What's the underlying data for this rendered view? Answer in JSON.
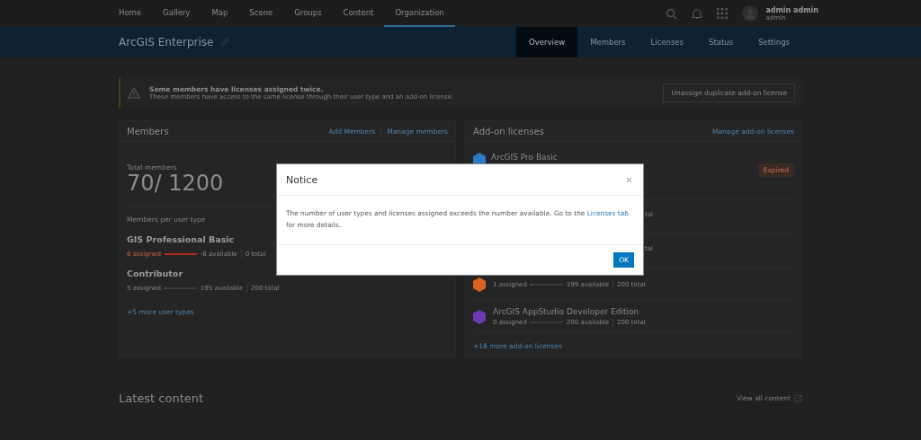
{
  "top_nav": {
    "tabs": [
      {
        "label": "Home",
        "selected": false
      },
      {
        "label": "Gallery",
        "selected": false
      },
      {
        "label": "Map",
        "selected": false
      },
      {
        "label": "Scene",
        "selected": false
      },
      {
        "label": "Groups",
        "selected": false
      },
      {
        "label": "Content",
        "selected": false
      },
      {
        "label": "Organization",
        "selected": true
      }
    ],
    "user": {
      "name": "admin admin",
      "username": "admin"
    }
  },
  "org_bar": {
    "title": "ArcGIS Enterprise",
    "tabs": [
      {
        "label": "Overview",
        "selected": true
      },
      {
        "label": "Members",
        "selected": false
      },
      {
        "label": "Licenses",
        "selected": false
      },
      {
        "label": "Status",
        "selected": false
      },
      {
        "label": "Settings",
        "selected": false
      }
    ]
  },
  "alert": {
    "title": "Some members have licenses assigned twice.",
    "message": "These members have access to the same license through their user type and an add-on license.",
    "button": "Unassign duplicate add-on license"
  },
  "members": {
    "title": "Members",
    "links": [
      "Add Members",
      "Manage members"
    ],
    "total_label": "Total members",
    "total": "70/ 1200",
    "per_type_label": "Members per user type",
    "types": [
      {
        "name": "GIS Professional Basic",
        "assigned": "6 assigned",
        "available": "-6 available",
        "total": "0 total",
        "level": 1,
        "over": true
      },
      {
        "name": "Contributor",
        "assigned": "5 assigned",
        "available": "195 available",
        "total": "200 total",
        "level": 0.025,
        "over": false
      }
    ],
    "more": "+5 more user types"
  },
  "addons": {
    "title": "Add-on licenses",
    "link": "Manage add-on licenses",
    "rows": [
      {
        "kind": "head",
        "name": "ArcGIS Pro Basic",
        "color": "#2a78c8",
        "badge": "Expired"
      },
      {
        "kind": "fragment",
        "text": "tal"
      },
      {
        "kind": "fragment",
        "text": "tal"
      },
      {
        "kind": "stats",
        "color": "#d8641f",
        "assigned": "1 assigned",
        "available": "199 available",
        "total": "200 total",
        "level": 0.005
      },
      {
        "kind": "full",
        "name": "ArcGIS AppStudio Developer Edition",
        "color": "#6a3ab0",
        "assigned": "0 assigned",
        "available": "200 available",
        "total": "200 total"
      }
    ],
    "more": "+18 more add-on licenses"
  },
  "latest": {
    "title": "Latest content",
    "link": "View all content"
  },
  "dialog": {
    "title": "Notice",
    "before": "The number of user types and licenses assigned exceeds the number available. Go to the ",
    "link": "Licenses tab",
    "after": " for more details.",
    "button": "OK"
  }
}
